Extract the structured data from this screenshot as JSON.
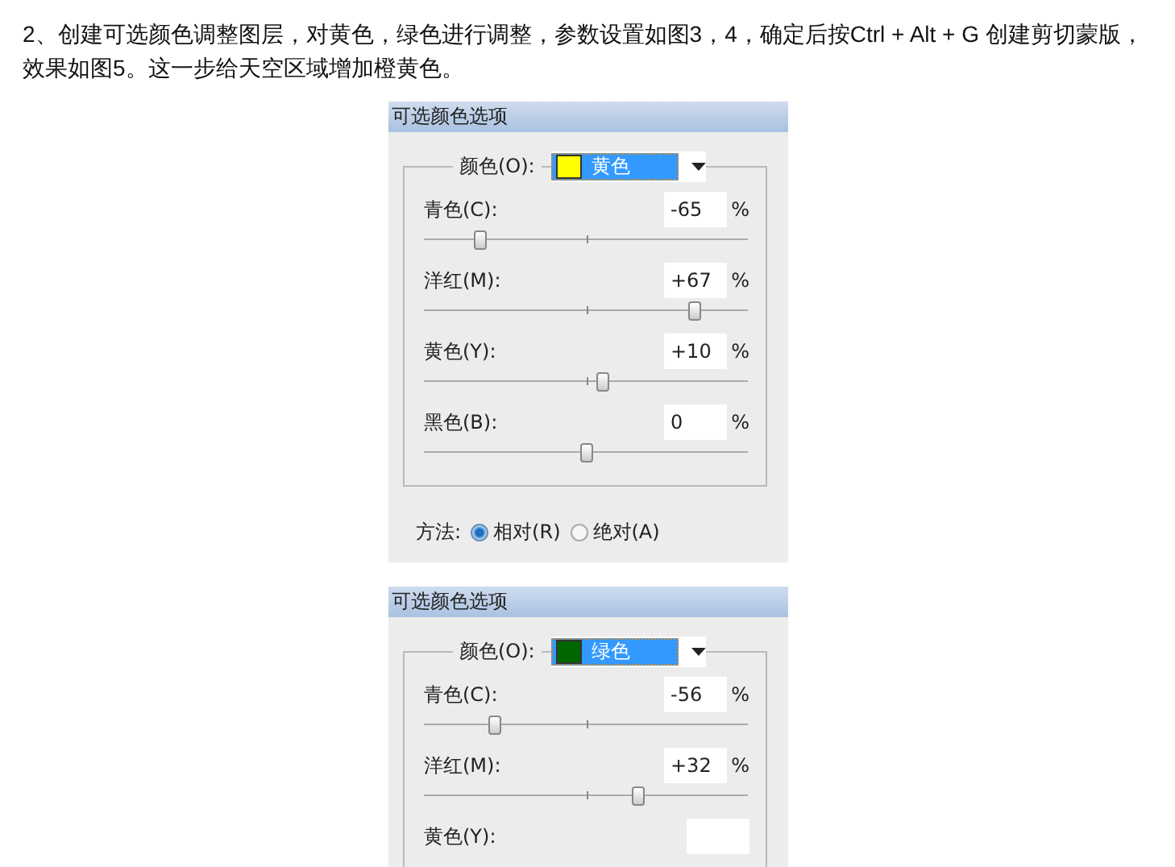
{
  "article": {
    "paragraph": "2、创建可选颜色调整图层，对黄色，绿色进行调整，参数设置如图3，4，确定后按Ctrl + Alt + G 创建剪切蒙版，效果如图5。这一步给天空区域增加橙黄色。"
  },
  "dialogs": [
    {
      "title": "可选颜色选项",
      "color_label": "颜色(O):",
      "color_value": "黄色",
      "color": "#ffff00",
      "sliders": [
        {
          "label": "青色(C):",
          "value": "-65",
          "unit": "%",
          "level": 0.175
        },
        {
          "label": "洋红(M):",
          "value": "+67",
          "unit": "%",
          "level": 0.835
        },
        {
          "label": "黄色(Y):",
          "value": "+10",
          "unit": "%",
          "level": 0.55
        },
        {
          "label": "黑色(B):",
          "value": "0",
          "unit": "%",
          "level": 0.5
        }
      ],
      "method": {
        "label": "方法:",
        "options": [
          {
            "label": "相对(R)",
            "selected": true
          },
          {
            "label": "绝对(A)",
            "selected": false
          }
        ]
      }
    },
    {
      "title": "可选颜色选项",
      "color_label": "颜色(O):",
      "color_value": "绿色",
      "color": "#006600",
      "sliders": [
        {
          "label": "青色(C):",
          "value": "-56",
          "unit": "%",
          "level": 0.22
        },
        {
          "label": "洋红(M):",
          "value": "+32",
          "unit": "%",
          "level": 0.66
        },
        {
          "label": "黄色(Y):"
        }
      ]
    }
  ]
}
